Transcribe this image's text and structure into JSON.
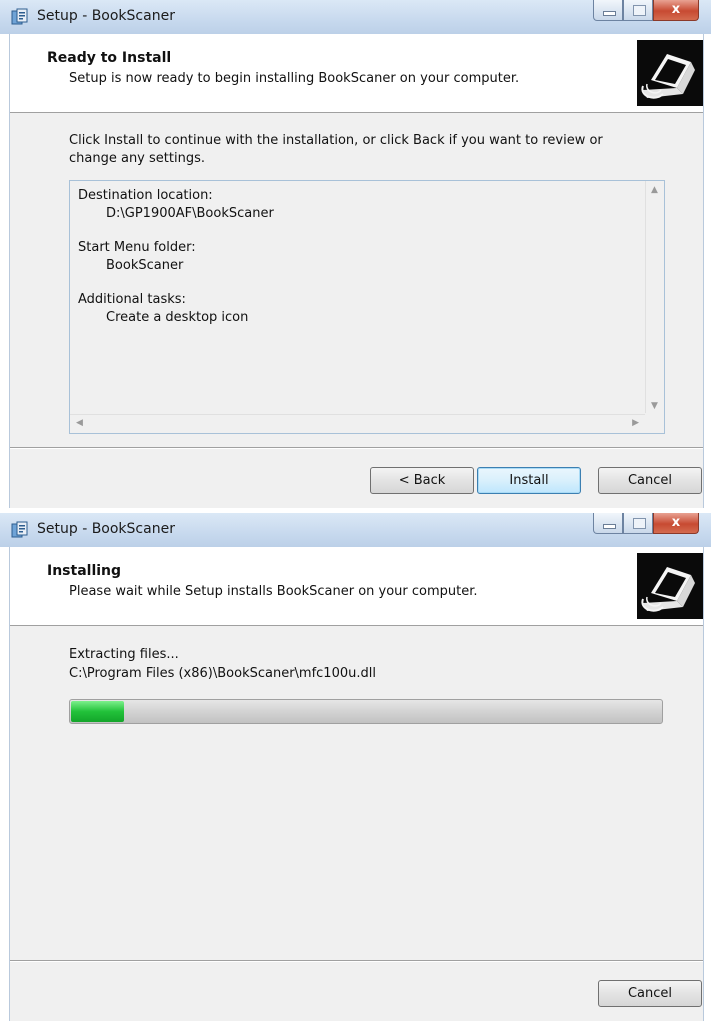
{
  "window1": {
    "title": "Setup - BookScaner",
    "header_title": "Ready to Install",
    "header_subtitle": "Setup is now ready to begin installing BookScaner on your computer.",
    "intro_line1": "Click Install to continue with the installation, or click Back if you want to review or",
    "intro_line2": "change any settings.",
    "memo": {
      "destination_label": "Destination location:",
      "destination_value": "D:\\GP1900AF\\BookScaner",
      "start_menu_label": "Start Menu folder:",
      "start_menu_value": "BookScaner",
      "tasks_label": "Additional tasks:",
      "tasks_value": "Create a desktop icon"
    },
    "buttons": {
      "back": "< Back",
      "install": "Install",
      "cancel": "Cancel"
    }
  },
  "window2": {
    "title": "Setup - BookScaner",
    "header_title": "Installing",
    "header_subtitle": "Please wait while Setup installs BookScaner on your computer.",
    "status_text": "Extracting files...",
    "file_path": "C:\\Program Files (x86)\\BookScaner\\mfc100u.dll",
    "progress_fraction": 0.09,
    "buttons": {
      "cancel": "Cancel"
    }
  },
  "caption_buttons": {
    "close_glyph": "x"
  },
  "colors": {
    "progress_green": "#22c23a",
    "default_button_border": "#3c7fb1",
    "close_button": "#c74a32"
  },
  "icons": [
    "setup-app-icon",
    "minimize-icon",
    "maximize-icon",
    "close-icon",
    "scanner-logo-icon"
  ]
}
